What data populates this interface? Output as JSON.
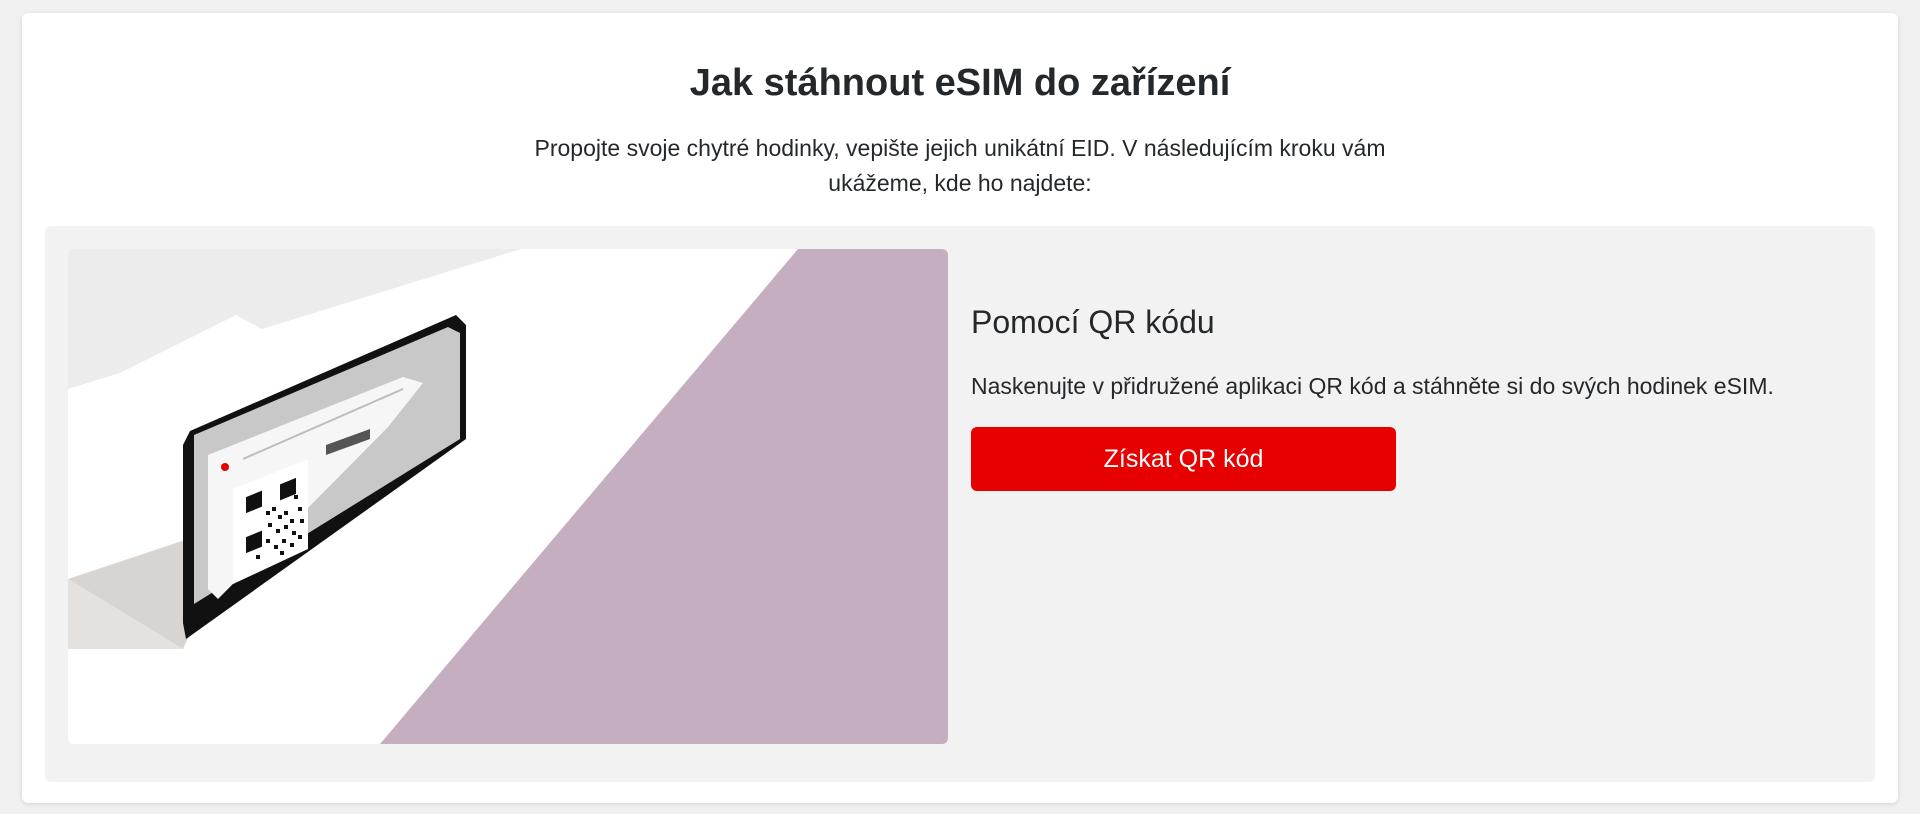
{
  "header": {
    "title": "Jak stáhnout eSIM do zařízení",
    "intro": "Propojte svoje chytré hodinky, vepište jejich unikátní EID. V následujícím kroku vám ukážeme, kde ho najdete:"
  },
  "option": {
    "title": "Pomocí QR kódu",
    "description": "Naskenujte v přidružené aplikaci QR kód a stáhněte si do svých hodinek eSIM.",
    "button_label": "Získat QR kód"
  },
  "illustration": {
    "icon": "laptop-qr-code-illustration"
  },
  "colors": {
    "accent": "#e60000",
    "panel_background": "#f2f2f2",
    "illustration_purple": "#c4aebf",
    "text": "#25282b"
  }
}
